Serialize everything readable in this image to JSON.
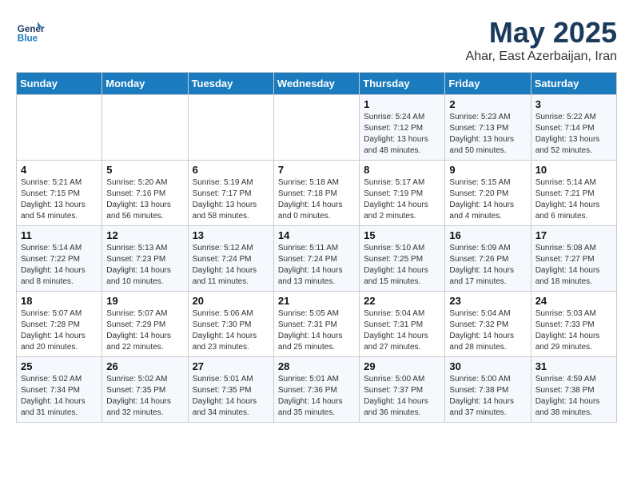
{
  "logo": {
    "text_general": "General",
    "text_blue": "Blue"
  },
  "header": {
    "title": "May 2025",
    "subtitle": "Ahar, East Azerbaijan, Iran"
  },
  "weekdays": [
    "Sunday",
    "Monday",
    "Tuesday",
    "Wednesday",
    "Thursday",
    "Friday",
    "Saturday"
  ],
  "weeks": [
    [
      {
        "day": "",
        "content": ""
      },
      {
        "day": "",
        "content": ""
      },
      {
        "day": "",
        "content": ""
      },
      {
        "day": "",
        "content": ""
      },
      {
        "day": "1",
        "content": "Sunrise: 5:24 AM\nSunset: 7:12 PM\nDaylight: 13 hours\nand 48 minutes."
      },
      {
        "day": "2",
        "content": "Sunrise: 5:23 AM\nSunset: 7:13 PM\nDaylight: 13 hours\nand 50 minutes."
      },
      {
        "day": "3",
        "content": "Sunrise: 5:22 AM\nSunset: 7:14 PM\nDaylight: 13 hours\nand 52 minutes."
      }
    ],
    [
      {
        "day": "4",
        "content": "Sunrise: 5:21 AM\nSunset: 7:15 PM\nDaylight: 13 hours\nand 54 minutes."
      },
      {
        "day": "5",
        "content": "Sunrise: 5:20 AM\nSunset: 7:16 PM\nDaylight: 13 hours\nand 56 minutes."
      },
      {
        "day": "6",
        "content": "Sunrise: 5:19 AM\nSunset: 7:17 PM\nDaylight: 13 hours\nand 58 minutes."
      },
      {
        "day": "7",
        "content": "Sunrise: 5:18 AM\nSunset: 7:18 PM\nDaylight: 14 hours\nand 0 minutes."
      },
      {
        "day": "8",
        "content": "Sunrise: 5:17 AM\nSunset: 7:19 PM\nDaylight: 14 hours\nand 2 minutes."
      },
      {
        "day": "9",
        "content": "Sunrise: 5:15 AM\nSunset: 7:20 PM\nDaylight: 14 hours\nand 4 minutes."
      },
      {
        "day": "10",
        "content": "Sunrise: 5:14 AM\nSunset: 7:21 PM\nDaylight: 14 hours\nand 6 minutes."
      }
    ],
    [
      {
        "day": "11",
        "content": "Sunrise: 5:14 AM\nSunset: 7:22 PM\nDaylight: 14 hours\nand 8 minutes."
      },
      {
        "day": "12",
        "content": "Sunrise: 5:13 AM\nSunset: 7:23 PM\nDaylight: 14 hours\nand 10 minutes."
      },
      {
        "day": "13",
        "content": "Sunrise: 5:12 AM\nSunset: 7:24 PM\nDaylight: 14 hours\nand 11 minutes."
      },
      {
        "day": "14",
        "content": "Sunrise: 5:11 AM\nSunset: 7:24 PM\nDaylight: 14 hours\nand 13 minutes."
      },
      {
        "day": "15",
        "content": "Sunrise: 5:10 AM\nSunset: 7:25 PM\nDaylight: 14 hours\nand 15 minutes."
      },
      {
        "day": "16",
        "content": "Sunrise: 5:09 AM\nSunset: 7:26 PM\nDaylight: 14 hours\nand 17 minutes."
      },
      {
        "day": "17",
        "content": "Sunrise: 5:08 AM\nSunset: 7:27 PM\nDaylight: 14 hours\nand 18 minutes."
      }
    ],
    [
      {
        "day": "18",
        "content": "Sunrise: 5:07 AM\nSunset: 7:28 PM\nDaylight: 14 hours\nand 20 minutes."
      },
      {
        "day": "19",
        "content": "Sunrise: 5:07 AM\nSunset: 7:29 PM\nDaylight: 14 hours\nand 22 minutes."
      },
      {
        "day": "20",
        "content": "Sunrise: 5:06 AM\nSunset: 7:30 PM\nDaylight: 14 hours\nand 23 minutes."
      },
      {
        "day": "21",
        "content": "Sunrise: 5:05 AM\nSunset: 7:31 PM\nDaylight: 14 hours\nand 25 minutes."
      },
      {
        "day": "22",
        "content": "Sunrise: 5:04 AM\nSunset: 7:31 PM\nDaylight: 14 hours\nand 27 minutes."
      },
      {
        "day": "23",
        "content": "Sunrise: 5:04 AM\nSunset: 7:32 PM\nDaylight: 14 hours\nand 28 minutes."
      },
      {
        "day": "24",
        "content": "Sunrise: 5:03 AM\nSunset: 7:33 PM\nDaylight: 14 hours\nand 29 minutes."
      }
    ],
    [
      {
        "day": "25",
        "content": "Sunrise: 5:02 AM\nSunset: 7:34 PM\nDaylight: 14 hours\nand 31 minutes."
      },
      {
        "day": "26",
        "content": "Sunrise: 5:02 AM\nSunset: 7:35 PM\nDaylight: 14 hours\nand 32 minutes."
      },
      {
        "day": "27",
        "content": "Sunrise: 5:01 AM\nSunset: 7:35 PM\nDaylight: 14 hours\nand 34 minutes."
      },
      {
        "day": "28",
        "content": "Sunrise: 5:01 AM\nSunset: 7:36 PM\nDaylight: 14 hours\nand 35 minutes."
      },
      {
        "day": "29",
        "content": "Sunrise: 5:00 AM\nSunset: 7:37 PM\nDaylight: 14 hours\nand 36 minutes."
      },
      {
        "day": "30",
        "content": "Sunrise: 5:00 AM\nSunset: 7:38 PM\nDaylight: 14 hours\nand 37 minutes."
      },
      {
        "day": "31",
        "content": "Sunrise: 4:59 AM\nSunset: 7:38 PM\nDaylight: 14 hours\nand 38 minutes."
      }
    ]
  ]
}
